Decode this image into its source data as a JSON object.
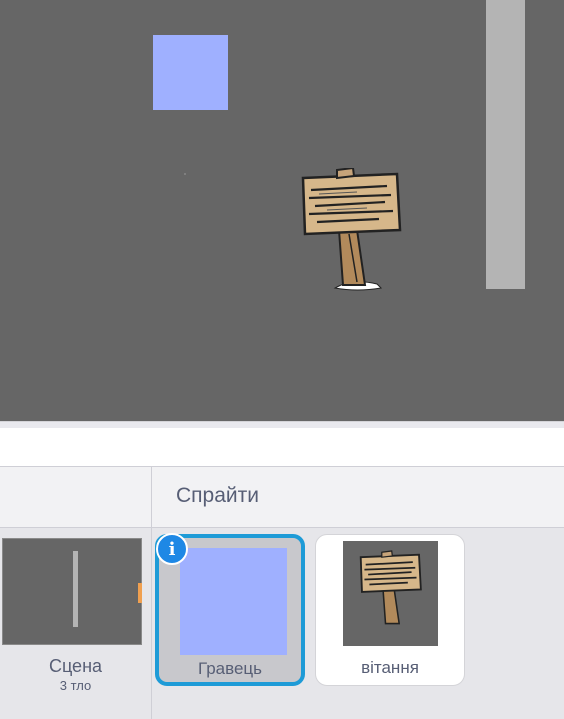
{
  "stage": {
    "background_color": "#666666",
    "sprites": [
      {
        "name": "player-sprite",
        "color": "#9fb0ff"
      },
      {
        "name": "wall-sprite",
        "color": "#b4b4b4"
      },
      {
        "name": "sign-sprite",
        "icon": "wooden-sign"
      }
    ]
  },
  "stage_panel": {
    "label": "Сцена",
    "backdrop_count": "3 тло"
  },
  "sprites_panel": {
    "title": "Спрайти",
    "sprites": [
      {
        "label": "Гравець",
        "selected": true,
        "color": "#9fb0ff"
      },
      {
        "label": "вітання",
        "selected": false,
        "icon": "wooden-sign"
      }
    ],
    "info_icon": "i"
  },
  "colors": {
    "selection": "#1e9bd7",
    "info_badge": "#1e88e5",
    "text": "#575e75"
  }
}
